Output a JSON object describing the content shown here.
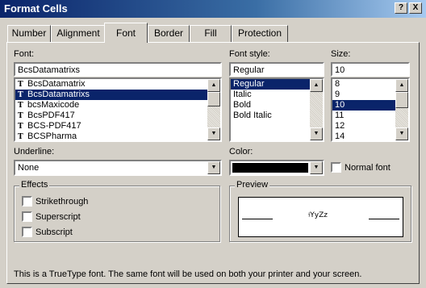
{
  "window": {
    "title": "Format Cells",
    "help_label": "?",
    "close_label": "X"
  },
  "tabs": [
    "Number",
    "Alignment",
    "Font",
    "Border",
    "Fill",
    "Protection"
  ],
  "active_tab": "Font",
  "font": {
    "label": "Font:",
    "value": "BcsDatamatrixs",
    "items": [
      "BcsDatamatrix",
      "BcsDatamatrixs",
      "bcsMaxicode",
      "BcsPDF417",
      "BCS-PDF417",
      "BCSPharma"
    ],
    "selected": "BcsDatamatrixs",
    "item_icon": "T"
  },
  "font_style": {
    "label": "Font style:",
    "value": "Regular",
    "items": [
      "Regular",
      "Italic",
      "Bold",
      "Bold Italic"
    ],
    "selected": "Regular"
  },
  "size": {
    "label": "Size:",
    "value": "10",
    "items": [
      "8",
      "9",
      "10",
      "11",
      "12",
      "14"
    ],
    "selected": "10"
  },
  "underline": {
    "label": "Underline:",
    "value": "None"
  },
  "color": {
    "label": "Color:",
    "swatch": "#000000",
    "normal_font_label": "Normal font"
  },
  "effects": {
    "label": "Effects",
    "items": [
      "Strikethrough",
      "Superscript",
      "Subscript"
    ]
  },
  "preview": {
    "label": "Preview",
    "sample": "⫮YyZz"
  },
  "footer": "This is a TrueType font.  The same font will be used on both your printer and your screen.",
  "colors": {
    "selection": "#0a246a",
    "dialog_bg": "#d4d0c8"
  }
}
